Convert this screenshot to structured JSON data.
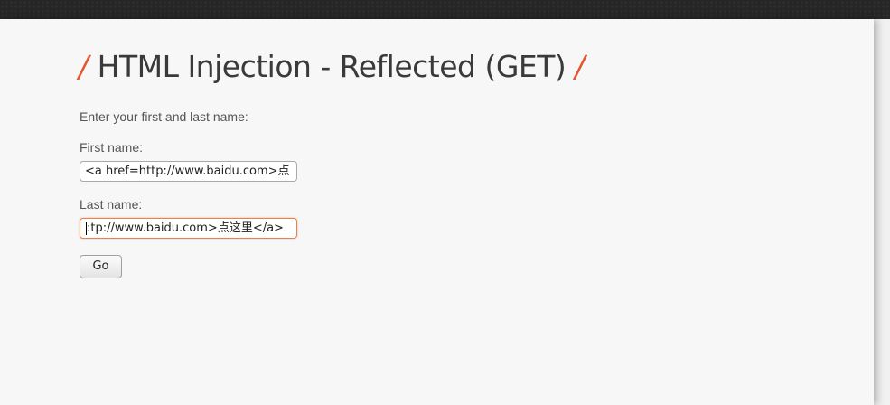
{
  "heading": {
    "slash_left": "/",
    "title": "HTML Injection - Reflected (GET)",
    "slash_right": "/"
  },
  "form": {
    "intro": "Enter your first and last name:",
    "first_label": "First name:",
    "first_value": "<a href=http://www.baidu.com>点",
    "last_label": "Last name:",
    "last_value": ":tp://www.baidu.com>点这里</a>",
    "go_label": "Go"
  },
  "colors": {
    "accent": "#e4572e",
    "focus_border": "#e2844d",
    "background": "#f7f7f7",
    "topbar": "#262626"
  }
}
